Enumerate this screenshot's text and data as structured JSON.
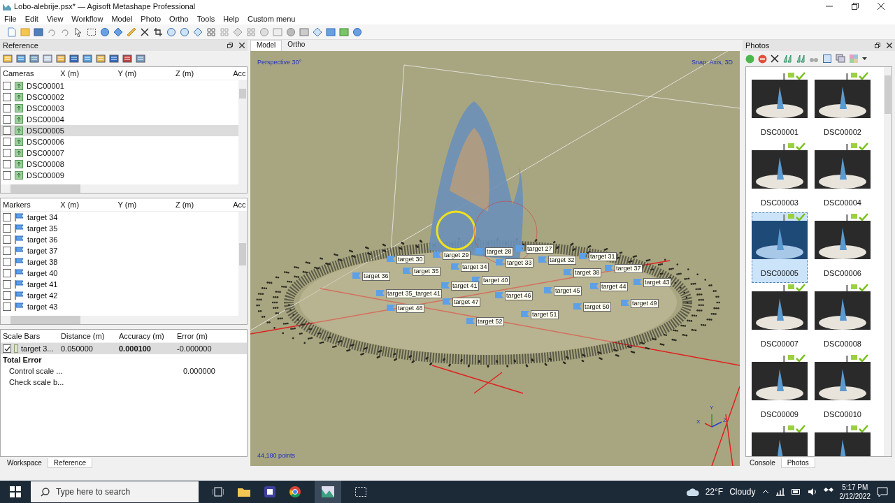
{
  "window": {
    "title": "Lobo-alebrije.psx* — Agisoft Metashape Professional"
  },
  "menu": [
    "File",
    "Edit",
    "View",
    "Workflow",
    "Model",
    "Photo",
    "Ortho",
    "Tools",
    "Help",
    "Custom menu"
  ],
  "reference_panel": {
    "title": "Reference",
    "cameras": {
      "columns": [
        "Cameras",
        "X (m)",
        "Y (m)",
        "Z (m)",
        "Acc"
      ],
      "rows": [
        {
          "label": "DSC00001",
          "checked": false,
          "selected": false
        },
        {
          "label": "DSC00002",
          "checked": false,
          "selected": false
        },
        {
          "label": "DSC00003",
          "checked": false,
          "selected": false
        },
        {
          "label": "DSC00004",
          "checked": false,
          "selected": false
        },
        {
          "label": "DSC00005",
          "checked": false,
          "selected": true
        },
        {
          "label": "DSC00006",
          "checked": false,
          "selected": false
        },
        {
          "label": "DSC00007",
          "checked": false,
          "selected": false
        },
        {
          "label": "DSC00008",
          "checked": false,
          "selected": false
        },
        {
          "label": "DSC00009",
          "checked": false,
          "selected": false
        }
      ]
    },
    "markers": {
      "columns": [
        "Markers",
        "X (m)",
        "Y (m)",
        "Z (m)",
        "Acc"
      ],
      "rows": [
        {
          "label": "target 34",
          "checked": false
        },
        {
          "label": "target 35",
          "checked": false
        },
        {
          "label": "target 36",
          "checked": false
        },
        {
          "label": "target 37",
          "checked": false
        },
        {
          "label": "target 38",
          "checked": false
        },
        {
          "label": "target 40",
          "checked": false
        },
        {
          "label": "target 41",
          "checked": false
        },
        {
          "label": "target 42",
          "checked": false
        },
        {
          "label": "target 43",
          "checked": false
        }
      ]
    },
    "scale_bars": {
      "columns": [
        "Scale Bars",
        "Distance (m)",
        "Accuracy (m)",
        "Error (m)"
      ],
      "rows": [
        {
          "label": "target 3...",
          "checked": true,
          "selected": true,
          "distance": "0.050000",
          "accuracy": "0.000100",
          "error": "-0.000000"
        }
      ],
      "total_error": {
        "label": "Total Error",
        "rows": [
          {
            "label": "Control scale ...",
            "error": "0.000000"
          },
          {
            "label": "Check scale b..."
          }
        ]
      }
    }
  },
  "left_tabs": [
    {
      "label": "Workspace",
      "selected": false
    },
    {
      "label": "Reference",
      "selected": true
    }
  ],
  "view_tabs": [
    {
      "label": "Model",
      "selected": true
    },
    {
      "label": "Ortho",
      "selected": false
    }
  ],
  "viewport": {
    "projection": "Perspective 30°",
    "snap": "Snap: Axis, 3D",
    "point_count": "44,180 points",
    "axes": [
      "X",
      "Y",
      "Z"
    ],
    "markers": [
      {
        "label": "target 30"
      },
      {
        "label": "target 29"
      },
      {
        "label": "target 28"
      },
      {
        "label": "target 27"
      },
      {
        "label": "target 31"
      },
      {
        "label": "target 32"
      },
      {
        "label": "target 33"
      },
      {
        "label": "target 34"
      },
      {
        "label": "target 35"
      },
      {
        "label": "target 36"
      },
      {
        "label": "target 37"
      },
      {
        "label": "target 38"
      },
      {
        "label": "target 40"
      },
      {
        "label": "target 41"
      },
      {
        "label": "target 35_target 41"
      },
      {
        "label": "target 44"
      },
      {
        "label": "target 45"
      },
      {
        "label": "target 43"
      },
      {
        "label": "target 46"
      },
      {
        "label": "target 47"
      },
      {
        "label": "target 48"
      },
      {
        "label": "target 49"
      },
      {
        "label": "target 50"
      },
      {
        "label": "target 51"
      },
      {
        "label": "target 52"
      }
    ]
  },
  "photos_panel": {
    "title": "Photos",
    "photos": [
      {
        "label": "DSC00001",
        "selected": false
      },
      {
        "label": "DSC00002",
        "selected": false
      },
      {
        "label": "DSC00003",
        "selected": false
      },
      {
        "label": "DSC00004",
        "selected": false
      },
      {
        "label": "DSC00005",
        "selected": true
      },
      {
        "label": "DSC00006",
        "selected": false
      },
      {
        "label": "DSC00007",
        "selected": false
      },
      {
        "label": "DSC00008",
        "selected": false
      },
      {
        "label": "DSC00009",
        "selected": false
      },
      {
        "label": "DSC00010",
        "selected": false
      },
      {
        "selected": false
      },
      {
        "selected": false
      }
    ],
    "tabs": [
      {
        "label": "Console",
        "selected": false
      },
      {
        "label": "Photos",
        "selected": true
      }
    ]
  },
  "taskbar": {
    "search_placeholder": "Type here to search",
    "temperature": "22°F",
    "condition": "Cloudy",
    "time": "5:17 PM",
    "date": "2/12/2022"
  }
}
